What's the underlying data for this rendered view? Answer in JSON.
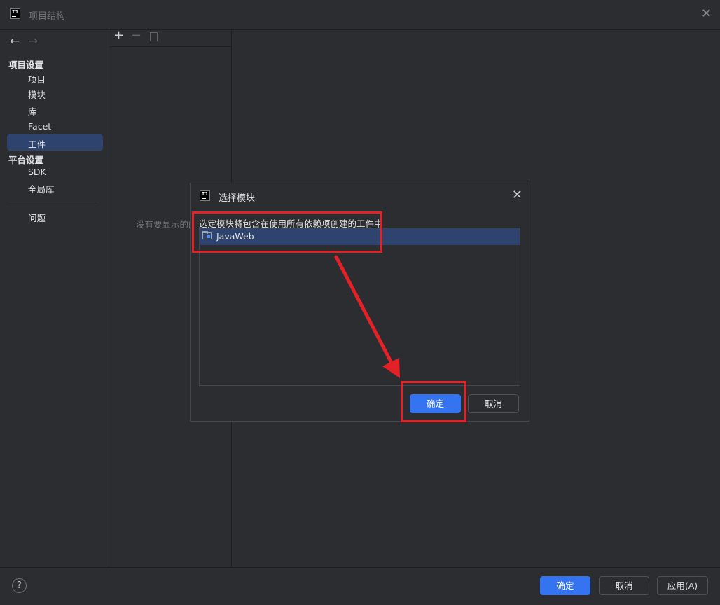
{
  "window": {
    "title": "项目结构",
    "logo_icon": "intellij-logo-icon",
    "close_icon": "close-icon"
  },
  "nav": {
    "back_icon": "arrow-left-icon",
    "forward_icon": "arrow-right-icon",
    "project_settings_header": "项目设置",
    "items_project": [
      "项目",
      "模块",
      "库",
      "Facet",
      "工件"
    ],
    "selected": "工件",
    "platform_settings_header": "平台设置",
    "items_platform": [
      "SDK",
      "全局库"
    ],
    "problems": "问题"
  },
  "mid": {
    "toolbar_icons": [
      "plus-icon",
      "minus-icon",
      "copy-icon"
    ],
    "empty_text": "没有要显示的内容"
  },
  "dialog": {
    "title": "选择模块",
    "description": "选定模块将包含在使用所有依赖项创建的工件中",
    "modules": [
      {
        "name": "JavaWeb",
        "selected": true,
        "icon": "module-folder-icon"
      }
    ],
    "ok_label": "确定",
    "cancel_label": "取消"
  },
  "footer": {
    "help_label": "?",
    "ok_label": "确定",
    "cancel_label": "取消",
    "apply_label": "应用(A)"
  },
  "annotations": {
    "color": "#e52128"
  },
  "colors": {
    "background": "#2b2d30",
    "selection": "#2e436e",
    "accent": "#3574f0"
  }
}
